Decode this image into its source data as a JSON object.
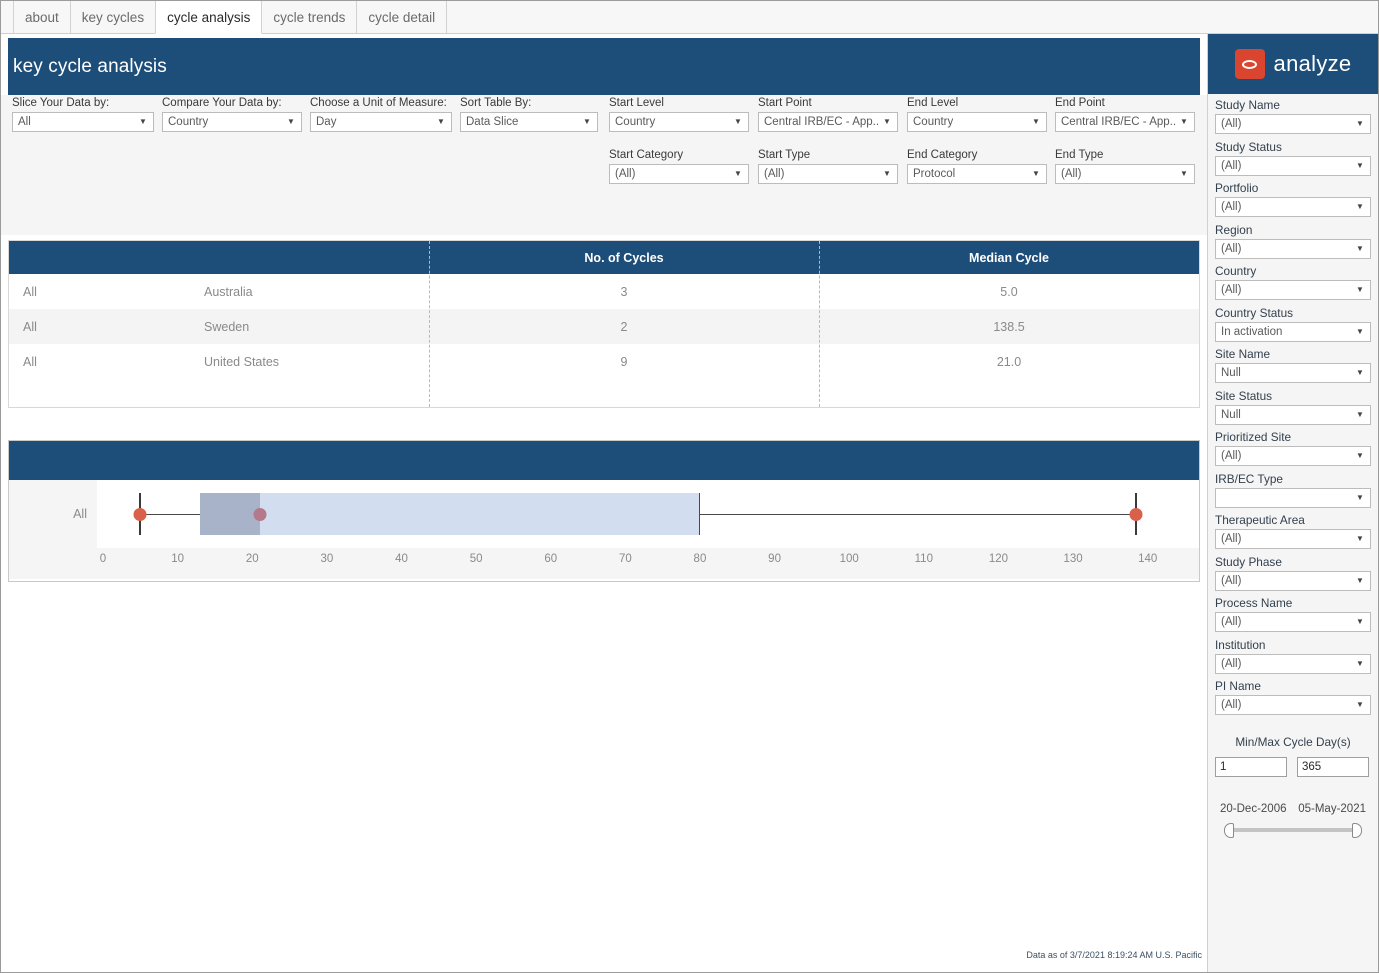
{
  "tabs": [
    {
      "label": "about",
      "active": false
    },
    {
      "label": "key cycles",
      "active": false
    },
    {
      "label": "cycle analysis",
      "active": true
    },
    {
      "label": "cycle trends",
      "active": false
    },
    {
      "label": "cycle detail",
      "active": false
    }
  ],
  "header": {
    "title": "key cycle analysis"
  },
  "brand": {
    "word": "analyze",
    "mark_color": "#d9452f",
    "bar_color": "#1d4e79"
  },
  "filters_top": [
    {
      "label": "Slice Your Data by:",
      "value": "All"
    },
    {
      "label": "Compare Your Data by:",
      "value": "Country"
    },
    {
      "label": "Choose a Unit of Measure:",
      "value": "Day"
    },
    {
      "label": "Sort Table By:",
      "value": "Data Slice"
    },
    {
      "label": "Start Level",
      "value": "Country"
    },
    {
      "label": "Start Point",
      "value": "Central IRB/EC - App..."
    },
    {
      "label": "End Level",
      "value": "Country"
    },
    {
      "label": "End Point",
      "value": "Central IRB/EC - App..."
    },
    {
      "label": "Start Category",
      "value": "(All)"
    },
    {
      "label": "Start Type",
      "value": "(All)"
    },
    {
      "label": "End Category",
      "value": "Protocol"
    },
    {
      "label": "End Type",
      "value": "(All)"
    }
  ],
  "table": {
    "headers": [
      "",
      "",
      "No. of Cycles",
      "Median Cycle"
    ],
    "rows": [
      {
        "slice": "All",
        "group": "Australia",
        "cycles": "3",
        "median": "5.0"
      },
      {
        "slice": "All",
        "group": "Sweden",
        "cycles": "2",
        "median": "138.5"
      },
      {
        "slice": "All",
        "group": "United States",
        "cycles": "9",
        "median": "21.0"
      }
    ]
  },
  "chart_data": {
    "type": "bar",
    "title": "",
    "xlabel": "",
    "ylabel": "",
    "categories": [
      "All"
    ],
    "tick_labels": [
      "0",
      "10",
      "20",
      "30",
      "40",
      "50",
      "60",
      "70",
      "80",
      "90",
      "100",
      "110",
      "120",
      "130",
      "140"
    ],
    "tick_values": [
      0,
      10,
      20,
      30,
      40,
      50,
      60,
      70,
      80,
      90,
      100,
      110,
      120,
      130,
      140
    ],
    "xlim": [
      0,
      145
    ],
    "grid": false,
    "legend": "none",
    "series": [
      {
        "name": "All",
        "row_label": "All",
        "whisker_low": 5,
        "q1": 13,
        "median": 21,
        "q3": 80,
        "whisker_high": 138.5,
        "values": [
          5,
          13,
          21,
          80,
          138.5
        ],
        "points": [
          {
            "value": 5,
            "color": "#d9604a",
            "kind": "end"
          },
          {
            "value": 21,
            "color": "#b4798a",
            "kind": "median"
          },
          {
            "value": 138.5,
            "color": "#d9604a",
            "kind": "end"
          }
        ],
        "box_fill_outer": "#d3ddf0",
        "box_fill_inner": "#a8b2c8"
      }
    ]
  },
  "sidebar": {
    "filters": [
      {
        "label": "Study Name",
        "value": "(All)"
      },
      {
        "label": "Study Status",
        "value": "(All)"
      },
      {
        "label": "Portfolio",
        "value": "(All)"
      },
      {
        "label": "Region",
        "value": "(All)"
      },
      {
        "label": "Country",
        "value": "(All)"
      },
      {
        "label": "Country Status",
        "value": "In activation"
      },
      {
        "label": "Site Name",
        "value": "Null"
      },
      {
        "label": "Site Status",
        "value": "Null"
      },
      {
        "label": "Prioritized Site",
        "value": "(All)"
      },
      {
        "label": "IRB/EC Type",
        "value": ""
      },
      {
        "label": "Therapeutic Area",
        "value": "(All)"
      },
      {
        "label": "Study Phase",
        "value": "(All)"
      },
      {
        "label": "Process Name",
        "value": "(All)"
      },
      {
        "label": "Institution",
        "value": "(All)"
      },
      {
        "label": "PI Name",
        "value": "(All)"
      }
    ],
    "minmax": {
      "title": "Min/Max Cycle Day(s)",
      "min": "1",
      "max": "365"
    },
    "date_range": {
      "start": "20-Dec-2006",
      "end": "05-May-2021"
    }
  },
  "footer": {
    "note": "Data as of 3/7/2021 8:19:24 AM U.S. Pacific"
  }
}
